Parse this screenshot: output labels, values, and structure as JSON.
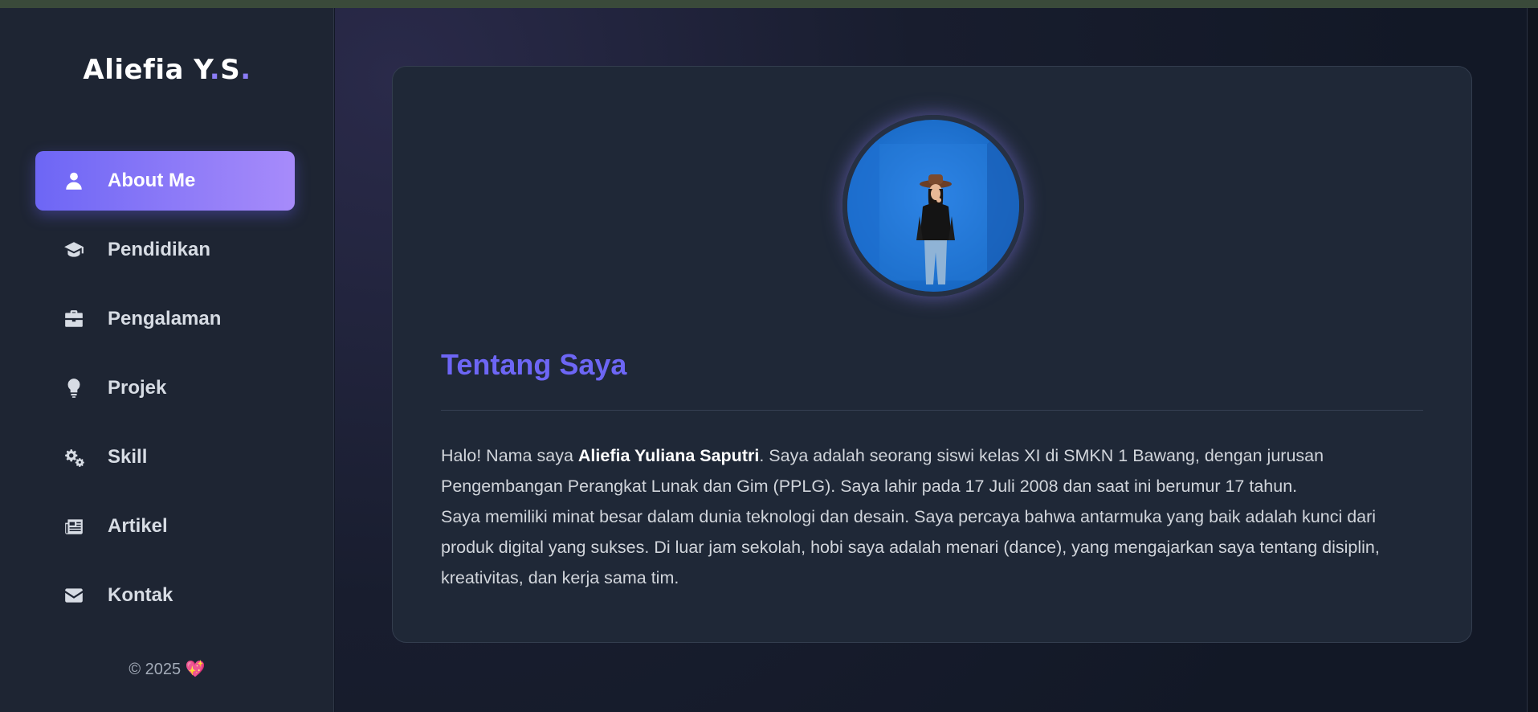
{
  "brand": {
    "name": "Aliefia Y",
    "dot1": ".",
    "mid": "S",
    "dot2": "."
  },
  "nav": [
    {
      "label": "About Me",
      "icon": "user-icon",
      "active": true
    },
    {
      "label": "Pendidikan",
      "icon": "graduation-cap-icon"
    },
    {
      "label": "Pengalaman",
      "icon": "briefcase-icon"
    },
    {
      "label": "Projek",
      "icon": "lightbulb-icon"
    },
    {
      "label": "Skill",
      "icon": "gears-icon"
    },
    {
      "label": "Artikel",
      "icon": "newspaper-icon"
    },
    {
      "label": "Kontak",
      "icon": "envelope-icon"
    }
  ],
  "footer": {
    "text": "© 2025",
    "heart": "💖"
  },
  "about": {
    "title": "Tentang Saya",
    "p1_pre": "Halo! Nama saya ",
    "p1_name": "Aliefia Yuliana Saputri",
    "p1_post": ". Saya adalah seorang siswi kelas XI di SMKN 1 Bawang, dengan jurusan Pengembangan Perangkat Lunak dan Gim (PPLG). Saya lahir pada 17 Juli 2008 dan saat ini berumur 17 tahun.",
    "p2": "Saya memiliki minat besar dalam dunia teknologi dan desain. Saya percaya bahwa antarmuka yang baik adalah kunci dari produk digital yang sukses. Di luar jam sekolah, hobi saya adalah menari (dance), yang mengajarkan saya tentang disiplin, kreativitas, dan kerja sama tim."
  },
  "colors": {
    "accent": "#6d66f5",
    "accent_light": "#a78bfa",
    "sidebar_bg": "#1e2533",
    "card_bg": "#1f2837",
    "page_bg": "#121826"
  }
}
